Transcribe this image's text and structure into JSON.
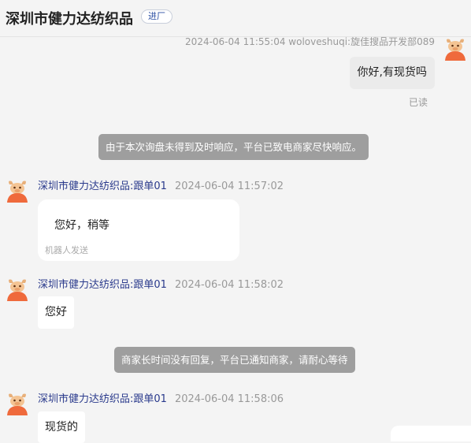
{
  "header": {
    "shop_name": "深圳市健力达纺织品",
    "badge": "进厂"
  },
  "messages": {
    "buyer": {
      "meta": "2024-06-04 11:55:04  woloveshuqi:旋佳搜品开发部089",
      "text": "你好,有现货吗",
      "status": "已读"
    },
    "notice1": "由于本次询盘未得到及时响应，平台已致电商家尽快响应。",
    "seller1": {
      "name": "深圳市健力达纺织品:跟单01",
      "time": "2024-06-04 11:57:02",
      "text": "您好，稍等",
      "tag": "机器人发送"
    },
    "seller2": {
      "name": "深圳市健力达纺织品:跟单01",
      "time": "2024-06-04 11:58:02",
      "text": "您好"
    },
    "notice2": "商家长时间没有回复，平台已通知商家，请耐心等待",
    "seller3": {
      "name": "深圳市健力达纺织品:跟单01",
      "time": "2024-06-04 11:58:06",
      "text": "现货的"
    }
  },
  "colors": {
    "link": "#2a3a8c",
    "notice_bg": "#9e9e9e",
    "bubble_self": "#ebebeb",
    "bubble_other": "#ffffff"
  },
  "icons": {
    "avatar": "mascot-avatar-icon"
  }
}
